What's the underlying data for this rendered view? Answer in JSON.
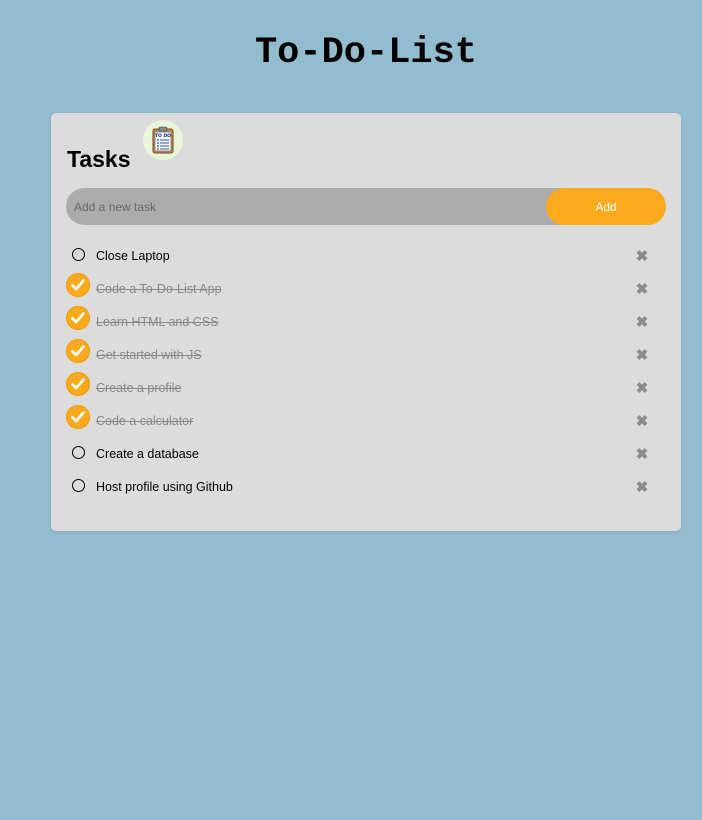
{
  "app": {
    "title": "To-Do-List"
  },
  "card": {
    "title": "Tasks",
    "icon": "clipboard-todo-icon"
  },
  "input": {
    "value": "",
    "placeholder": "Add a new task"
  },
  "add_button": {
    "label": "Add"
  },
  "colors": {
    "background": "#93bccf",
    "card": "#dcdcdc",
    "accent": "#fcaa1d",
    "input_bg": "#ababab",
    "done_text": "#8a8a8a",
    "delete_icon": "#8b8b8b"
  },
  "tasks": [
    {
      "text": "Close Laptop",
      "done": false,
      "delete_glyph": "✖"
    },
    {
      "text": "Code a To-Do-List App",
      "done": true,
      "delete_glyph": "✖"
    },
    {
      "text": "Learn HTML and CSS",
      "done": true,
      "delete_glyph": "✖"
    },
    {
      "text": "Get started with JS",
      "done": true,
      "delete_glyph": "✖"
    },
    {
      "text": "Create a profile",
      "done": true,
      "delete_glyph": "✖"
    },
    {
      "text": "Code a calculator",
      "done": true,
      "delete_glyph": "✖"
    },
    {
      "text": "Create a database",
      "done": false,
      "delete_glyph": "✖"
    },
    {
      "text": "Host profile using Github",
      "done": false,
      "delete_glyph": "✖"
    }
  ]
}
